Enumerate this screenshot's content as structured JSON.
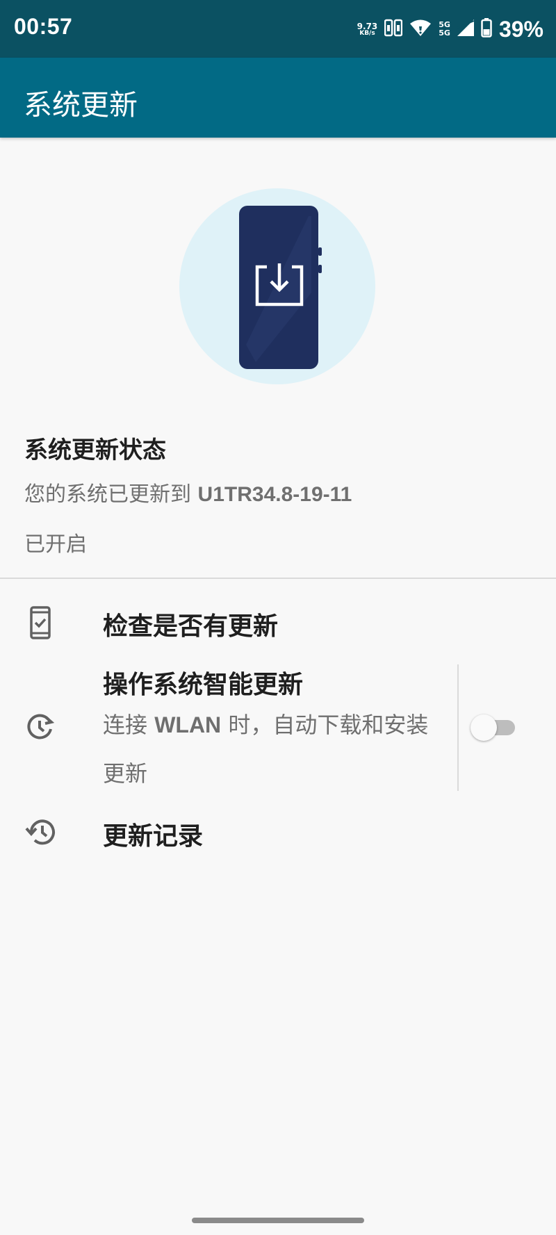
{
  "status_bar": {
    "time": "00:57",
    "net_speed_value": "9.73",
    "net_speed_unit": "KB/s",
    "signal_1": "5G",
    "signal_2": "5G",
    "battery": "39%"
  },
  "app_bar": {
    "title": "系统更新"
  },
  "update_status": {
    "title": "系统更新状态",
    "version_prefix": "您的系统已更新到 ",
    "version": "U1TR34.8-19-11",
    "state": "已开启"
  },
  "items": {
    "check": {
      "title": "检查是否有更新",
      "icon": "phone-check-icon"
    },
    "smart": {
      "title": "操作系统智能更新",
      "subtitle_a": "连接 ",
      "subtitle_em": "WLAN",
      "subtitle_b": " 时，自动下载和安装更新",
      "icon": "schedule-refresh-icon",
      "toggle_on": false
    },
    "history": {
      "title": "更新记录",
      "icon": "history-icon"
    }
  },
  "colors": {
    "status_bar": "#0b5162",
    "app_bar": "#026a85",
    "background": "#f8f8f8",
    "hero_circle": "#dff2f8",
    "phone_body": "#1f2f5e"
  }
}
